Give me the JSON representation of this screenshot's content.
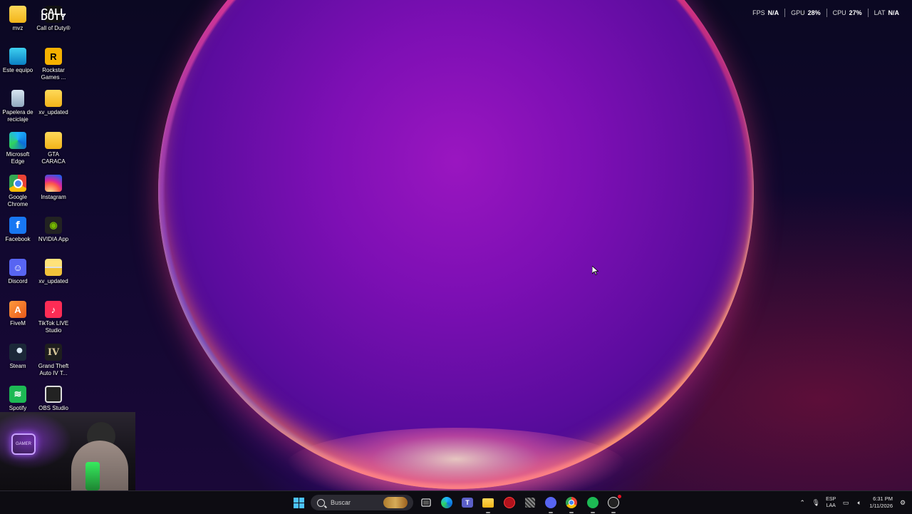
{
  "performance_overlay": {
    "fps_label": "FPS",
    "fps_value": "N/A",
    "gpu_label": "GPU",
    "gpu_value": "28%",
    "cpu_label": "CPU",
    "cpu_value": "27%",
    "lat_label": "LAT",
    "lat_value": "N/A"
  },
  "desktop_icons": [
    {
      "label": "mvz",
      "icon": "folder-icon"
    },
    {
      "label": "Este equipo",
      "icon": "this-pc-icon"
    },
    {
      "label": "Papelera de reciclaje",
      "icon": "recycle-bin-icon"
    },
    {
      "label": "Microsoft Edge",
      "icon": "edge-icon"
    },
    {
      "label": "Google Chrome",
      "icon": "chrome-icon"
    },
    {
      "label": "Facebook",
      "icon": "facebook-icon"
    },
    {
      "label": "Discord",
      "icon": "discord-icon"
    },
    {
      "label": "FiveM",
      "icon": "fivem-icon"
    },
    {
      "label": "Steam",
      "icon": "steam-icon"
    },
    {
      "label": "Spotify",
      "icon": "spotify-icon"
    },
    {
      "label": "Call of Duty®",
      "icon": "call-of-duty-icon"
    },
    {
      "label": "Rockstar Games ...",
      "icon": "rockstar-games-icon"
    },
    {
      "label": "xv_updated",
      "icon": "folder-icon"
    },
    {
      "label": "GTA CARACA",
      "icon": "folder-icon"
    },
    {
      "label": "Instagram",
      "icon": "instagram-icon"
    },
    {
      "label": "NVIDIA App",
      "icon": "nvidia-icon"
    },
    {
      "label": "xv_updated",
      "icon": "zip-folder-icon"
    },
    {
      "label": "TikTok LIVE Studio",
      "icon": "tiktok-icon"
    },
    {
      "label": "Grand Theft Auto IV T...",
      "icon": "gta-iv-icon"
    },
    {
      "label": "OBS Studio",
      "icon": "obs-icon"
    }
  ],
  "icon_glyphs": {
    "cod": "CALL\nDUTY",
    "rockstar": "R",
    "facebook": "f",
    "discord": "☺",
    "fivem": "A",
    "nvidia": "◉",
    "tiktok": "♪",
    "gta4": "IV",
    "spotify": "≋",
    "shortcut": "↗"
  },
  "webcam": {
    "sign_text": "GAMER"
  },
  "taskbar": {
    "search_placeholder": "Buscar",
    "pinned": [
      "start-icon",
      "search-icon",
      "task-view-icon",
      "edge-icon",
      "teams-icon",
      "file-explorer-icon",
      "app-red-icon",
      "app-grid-icon",
      "discord-icon",
      "chrome-icon",
      "spotify-icon",
      "obs-icon"
    ],
    "tray": {
      "language_top": "ESP",
      "language_bottom": "LAA",
      "time": "6:31 PM",
      "date": "1/11/2026"
    }
  },
  "colors": {
    "accent": "#4cc2ff",
    "wallpaper_center": "#8a10b8",
    "rim": "#ff5a8a"
  }
}
